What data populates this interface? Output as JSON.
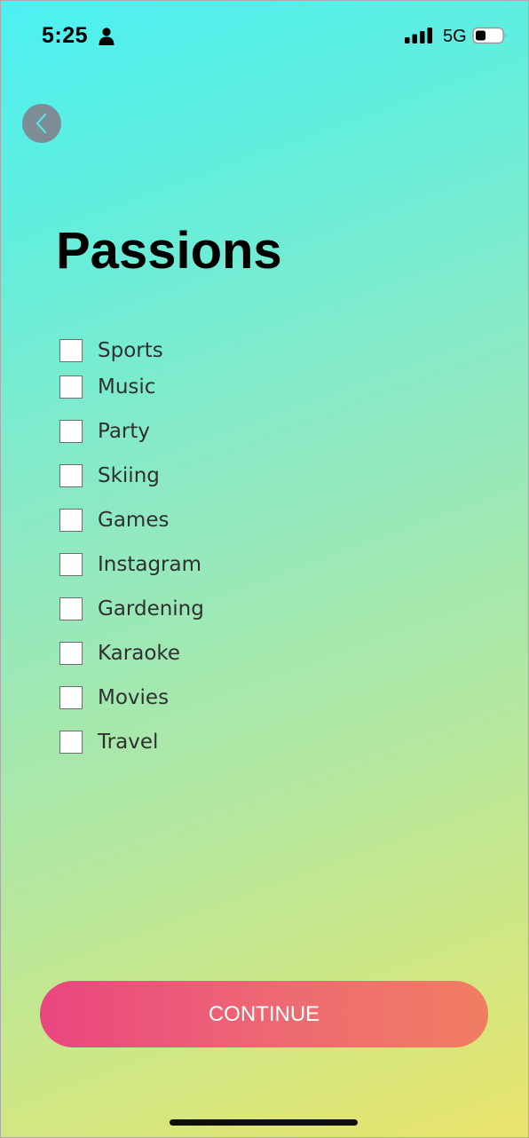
{
  "status_bar": {
    "time": "5:25",
    "network": "5G",
    "icons": [
      "person-icon",
      "signal-bars-icon",
      "battery-icon"
    ]
  },
  "header": {
    "back_icon": "chevron-left-icon",
    "title": "Passions"
  },
  "options": [
    {
      "label": "Sports",
      "checked": false
    },
    {
      "label": "Music",
      "checked": false
    },
    {
      "label": "Party",
      "checked": false
    },
    {
      "label": "Skiing",
      "checked": false
    },
    {
      "label": "Games",
      "checked": false
    },
    {
      "label": "Instagram",
      "checked": false
    },
    {
      "label": "Gardening",
      "checked": false
    },
    {
      "label": "Karaoke",
      "checked": false
    },
    {
      "label": "Movies",
      "checked": false
    },
    {
      "label": "Travel",
      "checked": false
    }
  ],
  "footer": {
    "continue_label": "CONTINUE"
  },
  "colors": {
    "background_top": "#4cf0f3",
    "background_bottom": "#e9e36b",
    "button_start": "#ea4580",
    "button_end": "#f07d62",
    "back_button": "#7c8d96"
  }
}
